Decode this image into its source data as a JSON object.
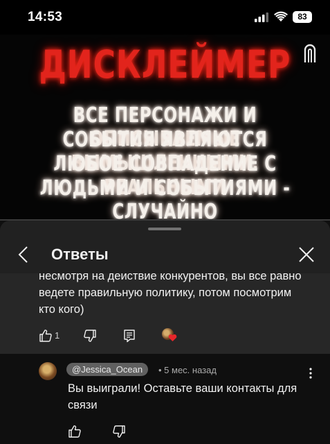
{
  "status_bar": {
    "time": "14:53",
    "battery": "83"
  },
  "video": {
    "title": "ДИСКЛЕЙМЕР",
    "lines": [
      "ВСЕ ПЕРСОНАЖИ И ОПИСЫВАЕМЫЕ",
      "СОБЫТИЯ ЯВЛЯЮТСЯ ВЫМЫШЛЕННЫМИ.",
      "ЛЮБОЕ СОВПАДЕНИЕ С РЕАЛЬНЫМИ",
      "ЛЮДЬМИ И СОБЫТИЯМИ - СЛУЧАЙНО"
    ]
  },
  "panel": {
    "title": "Ответы"
  },
  "parent_comment": {
    "text_lines": [
      "несмотря на действие конкурентов, вы все равно",
      "ведете правильную политику, потом посмотрим",
      "кто кого)"
    ],
    "like_count": "1"
  },
  "reply": {
    "author": "@Jessica_Ocean",
    "time": "• 5 мес. назад",
    "text_lines": [
      "Вы выиграли! Оставьте ваши контакты для",
      "связи"
    ]
  },
  "colors": {
    "heart": "#e6262a",
    "title_red": "#e2241c"
  }
}
